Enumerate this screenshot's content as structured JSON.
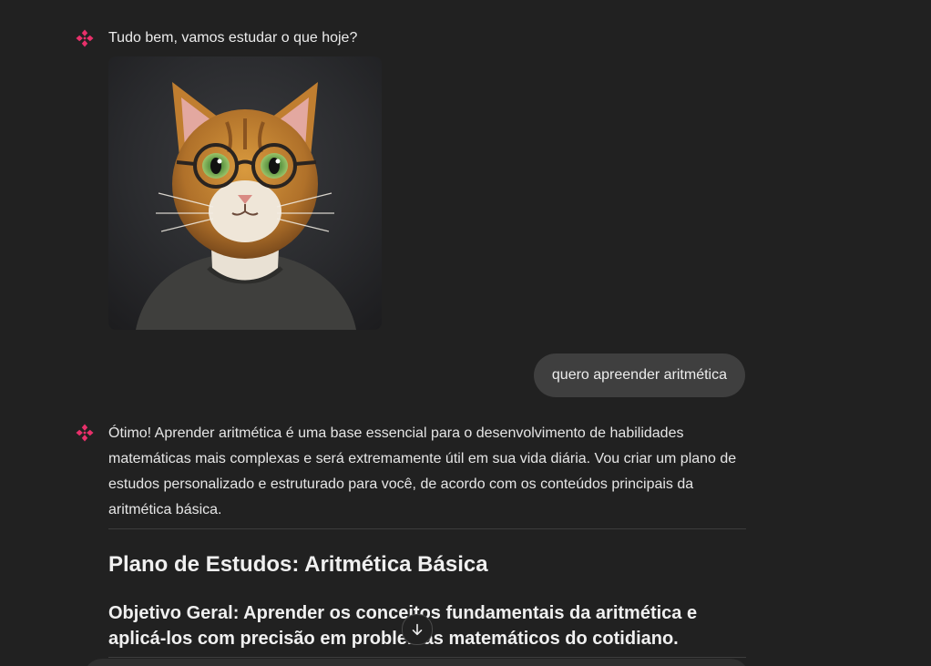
{
  "conversation": {
    "assistant_greeting": "Tudo bem, vamos estudar o que hoje?",
    "user_message": "quero apreender aritmética",
    "assistant_reply": {
      "paragraph": "Ótimo! Aprender aritmética é uma base essencial para o desenvolvimento de habilidades matemáticas mais complexas e será extremamente útil em sua vida diária. Vou criar um plano de estudos personalizado e estruturado para você, de acordo com os conteúdos principais da aritmética básica.",
      "heading": "Plano de Estudos: Aritmética Básica",
      "subheading": "Objetivo Geral: Aprender os conceitos fundamentais da aritmética e aplicá-los com precisão em problemas matemáticos do cotidiano."
    }
  },
  "icons": {
    "assistant": "assistant-logo-icon",
    "scroll": "arrow-down-icon"
  },
  "colors": {
    "background": "#212121",
    "assistant_logo": "#e8306a",
    "user_bubble": "#3f3f3f",
    "text": "#ececec"
  }
}
